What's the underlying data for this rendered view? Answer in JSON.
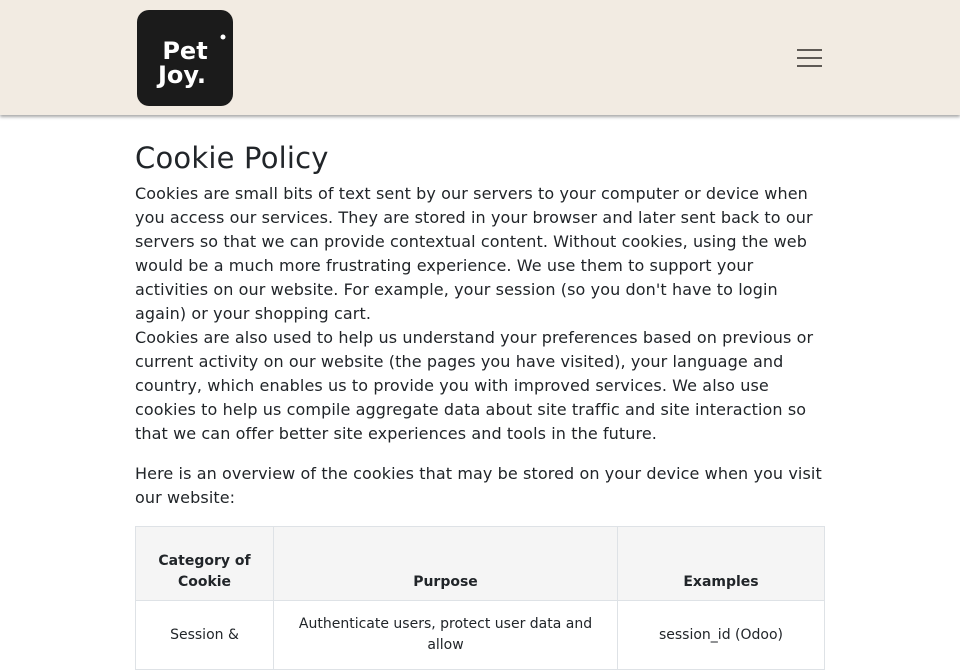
{
  "header": {
    "logo_text": "Pet Joy",
    "menu_icon": "hamburger-menu-icon"
  },
  "page": {
    "title": "Cookie Policy",
    "paragraphs": [
      "Cookies are small bits of text sent by our servers to your computer or device when you access our services. They are stored in your browser and later sent back to our servers so that we can provide contextual content. Without cookies, using the web would be a much more frustrating experience. We use them to support your activities on our website. For example, your session (so you don't have to login again) or your shopping cart.",
      "Cookies are also used to help us understand your preferences based on previous or current activity on our website (the pages you have visited), your language and country, which enables us to provide you with improved services. We also use cookies to help us compile aggregate data about site traffic and site interaction so that we can offer better site experiences and tools in the future."
    ],
    "overview": "Here is an overview of the cookies that may be stored on your device when you visit our website:"
  },
  "table": {
    "headers": [
      "Category of Cookie",
      "Purpose",
      "Examples"
    ],
    "rows": [
      [
        "Session &",
        "Authenticate users, protect user data and allow",
        "session_id (Odoo)"
      ]
    ]
  },
  "colors": {
    "header_bg": "#f2ebe2",
    "logo_bg": "#1b1b1b",
    "text": "#212529"
  }
}
